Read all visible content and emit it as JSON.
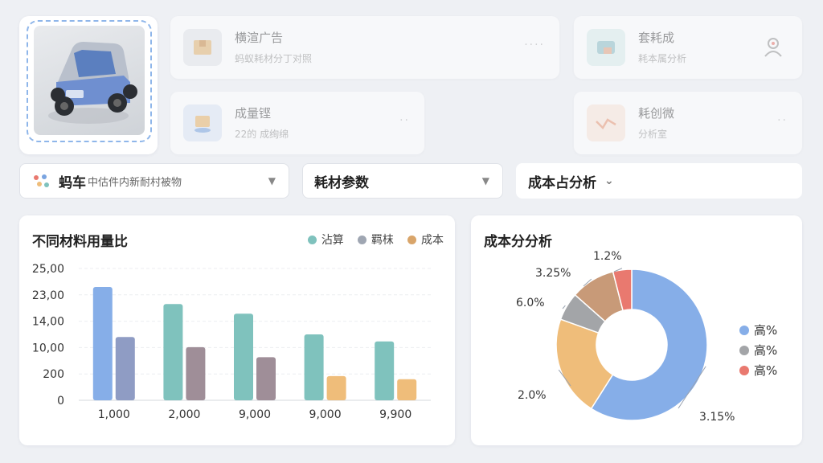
{
  "top_cards": [
    {
      "title": "横渲广告",
      "subtitle": "蚂蚁耗材分丁对照",
      "more": "····"
    },
    {
      "title": "成量铿",
      "subtitle": "22的 成绚绵",
      "more": "··"
    },
    {
      "title": "套耗成",
      "subtitle": "耗本属分析",
      "more": ""
    },
    {
      "title": "耗创微",
      "subtitle": "分析室",
      "more": "··"
    }
  ],
  "dropdowns": {
    "brand": "蚂车",
    "brand_sub": "中估件内新耐村被物",
    "params": "耗材参数",
    "cost": "成本占分析"
  },
  "colors": {
    "blue": "#86aee8",
    "purple": "#8f9cc4",
    "teal": "#7fc2bd",
    "taupe": "#9f8e98",
    "orange": "#efbd7a",
    "gray": "#a3a5a8",
    "brown": "#c89a78",
    "red": "#e9796f"
  },
  "bar_chart": {
    "title": "不同材料用量比",
    "legend": [
      "沾算",
      "羁枺",
      "成本"
    ]
  },
  "chart_data": [
    {
      "type": "bar",
      "title": "不同材料用量比",
      "categories": [
        "1,000",
        "2,000",
        "9,000",
        "9,000",
        "9,900"
      ],
      "y_tick_labels": [
        "25,00",
        "23,00",
        "14,00",
        "10,00",
        "200",
        "0"
      ],
      "legend": [
        "沾算",
        "羁枺",
        "成本"
      ],
      "series": [
        {
          "name": "沾算",
          "values": [
            25.8,
            21.9,
            19.7,
            15.0,
            13.4
          ]
        },
        {
          "name": "羁枺",
          "values": [
            14.4,
            12.1,
            9.8,
            5.5,
            4.8
          ]
        }
      ],
      "ylim": [
        0,
        30
      ],
      "grid": true
    },
    {
      "type": "pie",
      "title": "成本分分析",
      "slices": [
        {
          "label": "3.15%",
          "value": 59.0
        },
        {
          "label": "2.0%",
          "value": 21.5
        },
        {
          "label": "6.0%",
          "value": 6.0
        },
        {
          "label": "3.25%",
          "value": 9.5
        },
        {
          "label": "1.2%",
          "value": 4.0
        }
      ],
      "legend": [
        "高%",
        "高%",
        "高%"
      ],
      "legend_placement": "right",
      "donut": true
    }
  ]
}
